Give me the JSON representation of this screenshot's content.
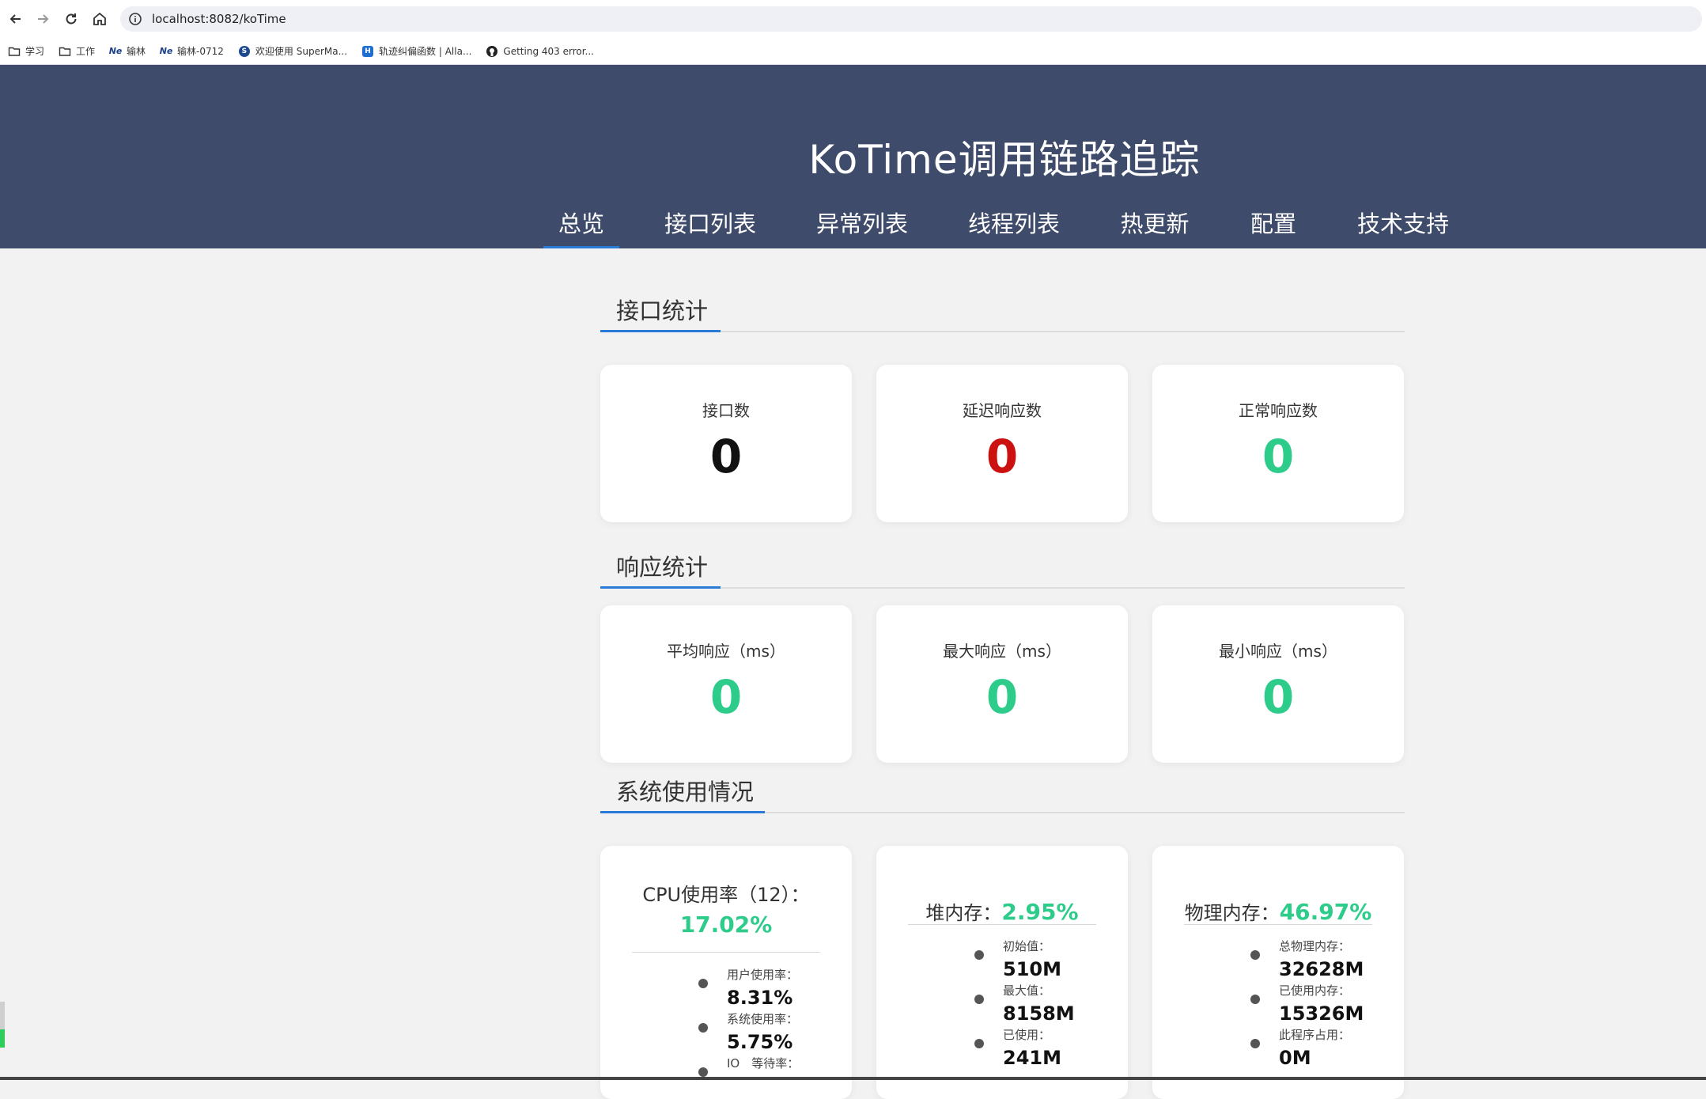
{
  "browser": {
    "url": "localhost:8082/koTime",
    "bookmarks": [
      {
        "label": "学习",
        "icon": "folder-icon"
      },
      {
        "label": "工作",
        "icon": "folder-icon"
      },
      {
        "label": "输林",
        "icon": "ne-logo-icon"
      },
      {
        "label": "输林-0712",
        "icon": "ne-logo-icon"
      },
      {
        "label": "欢迎使用 SuperMa...",
        "icon": "supermap-icon"
      },
      {
        "label": "轨迹纠偏函数 | Alla...",
        "icon": "hexagon-icon"
      },
      {
        "label": "Getting 403 error...",
        "icon": "github-icon"
      }
    ]
  },
  "header": {
    "title": "KoTime调用链路追踪",
    "tabs": [
      "总览",
      "接口列表",
      "异常列表",
      "线程列表",
      "热更新",
      "配置",
      "技术支持"
    ],
    "active_tab": 0
  },
  "sections": {
    "api_stats": "接口统计",
    "response_stats": "响应统计",
    "system_usage": "系统使用情况"
  },
  "api_cards": [
    {
      "label": "接口数",
      "value": "0",
      "color": "#111111"
    },
    {
      "label": "延迟响应数",
      "value": "0",
      "color": "#cc1111"
    },
    {
      "label": "正常响应数",
      "value": "0",
      "color": "#2ecc8a"
    }
  ],
  "response_cards": [
    {
      "label": "平均响应（ms）",
      "value": "0"
    },
    {
      "label": "最大响应（ms）",
      "value": "0"
    },
    {
      "label": "最小响应（ms）",
      "value": "0"
    }
  ],
  "system": {
    "cpu": {
      "title": "CPU使用率（12）：",
      "percent": "17.02%",
      "items": [
        {
          "label": "用户使用率：",
          "value": "8.31%"
        },
        {
          "label": "系统使用率：",
          "value": "5.75%"
        },
        {
          "label": "IO　等待率：",
          "value": ""
        }
      ]
    },
    "heap": {
      "title": "堆内存：",
      "percent": "2.95%",
      "items": [
        {
          "label": "初始值：",
          "value": "510M"
        },
        {
          "label": "最大值：",
          "value": "8158M"
        },
        {
          "label": "已使用：",
          "value": "241M"
        }
      ]
    },
    "physical": {
      "title": "物理内存：",
      "percent": "46.97%",
      "items": [
        {
          "label": "总物理内存：",
          "value": "32628M"
        },
        {
          "label": "已使用内存：",
          "value": "15326M"
        },
        {
          "label": "此程序占用：",
          "value": "0M"
        }
      ]
    }
  },
  "colors": {
    "header_bg": "#3f4b6a",
    "accent": "#2a7ad8",
    "green": "#2ecc8a",
    "red": "#cc1111"
  }
}
